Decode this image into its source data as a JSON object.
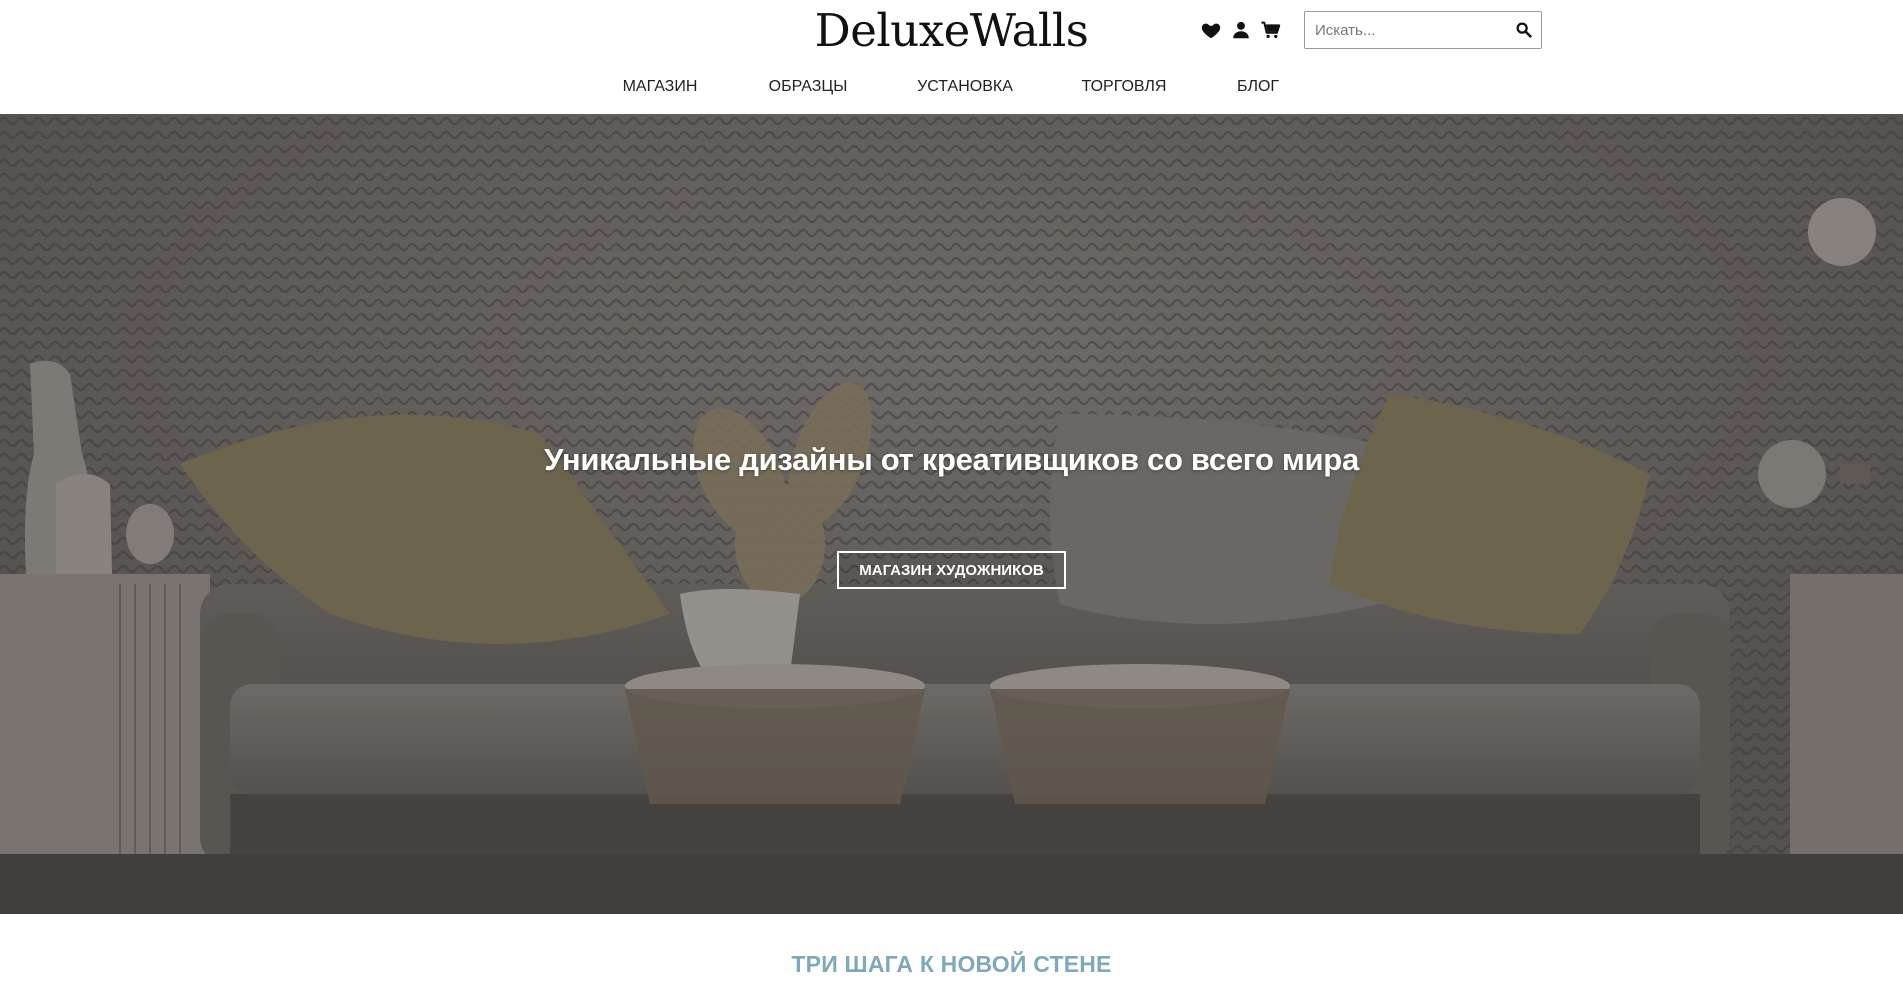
{
  "header": {
    "logo": "DeluxeWalls",
    "icons": [
      "heart-icon",
      "user-icon",
      "cart-icon"
    ],
    "search": {
      "placeholder": "Искать...",
      "value": ""
    }
  },
  "nav": {
    "items": [
      {
        "label": "МАГАЗИН"
      },
      {
        "label": "ОБРАЗЦЫ"
      },
      {
        "label": "УСТАНОВКА"
      },
      {
        "label": "ТОРГОВЛЯ"
      },
      {
        "label": "БЛОГ"
      }
    ]
  },
  "hero": {
    "title": "Уникальные дизайны от креативщиков со всего мира",
    "button_label": "МАГАЗИН ХУДОЖНИКОВ"
  },
  "section": {
    "title": "ТРИ ШАГА К НОВОЙ СТЕНЕ"
  },
  "colors": {
    "accent": "#7fa9b8",
    "text": "#222222",
    "hero_overlay": "#5a5754"
  }
}
